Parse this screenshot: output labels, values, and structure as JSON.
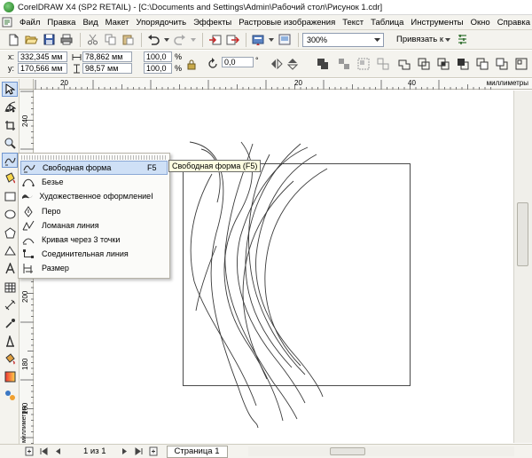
{
  "window": {
    "title": "CorelDRAW X4 (SP2 RETAIL) - [C:\\Documents and Settings\\Admin\\Рабочий стол\\Рисунок 1.cdr]"
  },
  "menu": [
    {
      "label": "Файл",
      "name": "menu-file"
    },
    {
      "label": "Правка",
      "name": "menu-edit"
    },
    {
      "label": "Вид",
      "name": "menu-view"
    },
    {
      "label": "Макет",
      "name": "menu-layout"
    },
    {
      "label": "Упорядочить",
      "name": "menu-arrange"
    },
    {
      "label": "Эффекты",
      "name": "menu-effects"
    },
    {
      "label": "Растровые изображения",
      "name": "menu-bitmaps"
    },
    {
      "label": "Текст",
      "name": "menu-text"
    },
    {
      "label": "Таблица",
      "name": "menu-table"
    },
    {
      "label": "Инструменты",
      "name": "menu-tools"
    },
    {
      "label": "Окно",
      "name": "menu-window"
    },
    {
      "label": "Справка",
      "name": "menu-help"
    }
  ],
  "toolbar": {
    "zoom_value": "300%",
    "snap_label": "Привязать к"
  },
  "propbar": {
    "x_label": "x:",
    "x_value": "332,345 мм",
    "y_label": "y:",
    "y_value": "170,566 мм",
    "width_value": "78,862 мм",
    "height_value": "98,57 мм",
    "scale_x": "100,0",
    "scale_y": "100,0",
    "percent": "%",
    "rotation": "0,0",
    "degree": "°"
  },
  "rulers": {
    "unit": "миллиметры",
    "h_labels": [
      "20",
      "20",
      "40"
    ],
    "v_labels": [
      "240",
      "220",
      "200",
      "180",
      "160"
    ]
  },
  "flyout": {
    "items": [
      {
        "label": "Свободная форма",
        "shortcut": "F5",
        "icon": "freehand-icon",
        "name": "flyout-freehand"
      },
      {
        "label": "Безье",
        "shortcut": "",
        "icon": "bezier-icon",
        "name": "flyout-bezier"
      },
      {
        "label": "Художественное оформление",
        "shortcut": "I",
        "icon": "artistic-media-icon",
        "name": "flyout-artistic-media"
      },
      {
        "label": "Перо",
        "shortcut": "",
        "icon": "pen-icon",
        "name": "flyout-pen"
      },
      {
        "label": "Ломаная линия",
        "shortcut": "",
        "icon": "polyline-icon",
        "name": "flyout-polyline"
      },
      {
        "label": "Кривая через 3 точки",
        "shortcut": "",
        "icon": "3-point-curve-icon",
        "name": "flyout-3point-curve"
      },
      {
        "label": "Соединительная линия",
        "shortcut": "",
        "icon": "connector-icon",
        "name": "flyout-connector"
      },
      {
        "label": "Размер",
        "shortcut": "",
        "icon": "dimension-icon",
        "name": "flyout-dimension"
      }
    ],
    "tooltip": "Свободная форма (F5)"
  },
  "statusbar": {
    "page_counter": "1 из 1",
    "page_tab": "Страница 1"
  }
}
